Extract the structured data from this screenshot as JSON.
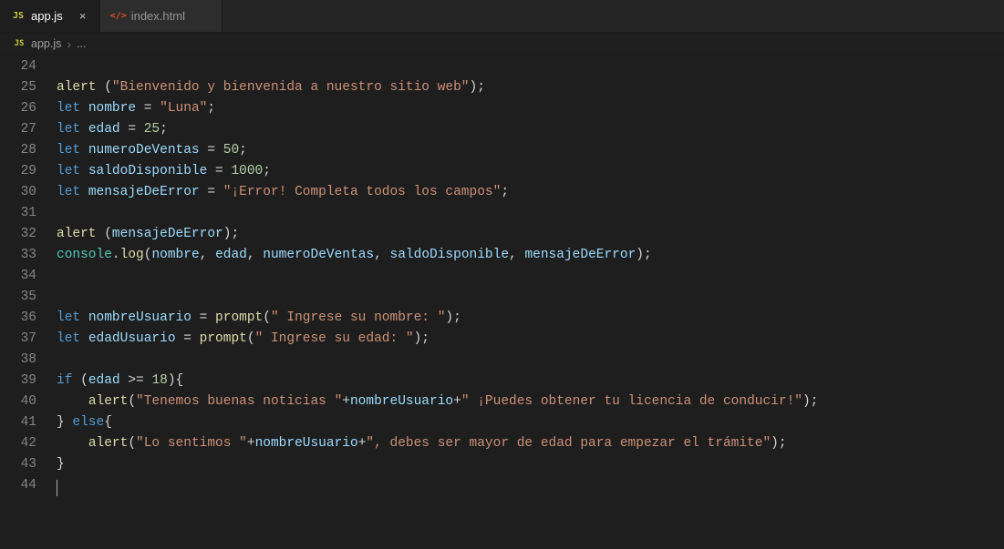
{
  "tabs": [
    {
      "label": "app.js",
      "icon": "JS",
      "iconClass": "js",
      "active": true
    },
    {
      "label": "index.html",
      "icon": "</>",
      "iconClass": "html",
      "active": false
    }
  ],
  "breadcrumb": {
    "icon": "JS",
    "file": "app.js",
    "rest": "..."
  },
  "lineStart": 24,
  "code": [
    [],
    [
      [
        "fn",
        "alert"
      ],
      [
        "pun",
        " ("
      ],
      [
        "str",
        "\"Bienvenido y bienvenida a nuestro sitio web\""
      ],
      [
        "pun",
        ");"
      ]
    ],
    [
      [
        "kw",
        "let"
      ],
      [
        "pun",
        " "
      ],
      [
        "var",
        "nombre"
      ],
      [
        "pun",
        " = "
      ],
      [
        "str",
        "\"Luna\""
      ],
      [
        "pun",
        ";"
      ]
    ],
    [
      [
        "kw",
        "let"
      ],
      [
        "pun",
        " "
      ],
      [
        "var",
        "edad"
      ],
      [
        "pun",
        " = "
      ],
      [
        "num",
        "25"
      ],
      [
        "pun",
        ";"
      ]
    ],
    [
      [
        "kw",
        "let"
      ],
      [
        "pun",
        " "
      ],
      [
        "var",
        "numeroDeVentas"
      ],
      [
        "pun",
        " = "
      ],
      [
        "num",
        "50"
      ],
      [
        "pun",
        ";"
      ]
    ],
    [
      [
        "kw",
        "let"
      ],
      [
        "pun",
        " "
      ],
      [
        "var",
        "saldoDisponible"
      ],
      [
        "pun",
        " = "
      ],
      [
        "num",
        "1000"
      ],
      [
        "pun",
        ";"
      ]
    ],
    [
      [
        "kw",
        "let"
      ],
      [
        "pun",
        " "
      ],
      [
        "var",
        "mensajeDeError"
      ],
      [
        "pun",
        " = "
      ],
      [
        "str",
        "\"¡Error! Completa todos los campos\""
      ],
      [
        "pun",
        ";"
      ]
    ],
    [],
    [
      [
        "fn",
        "alert"
      ],
      [
        "pun",
        " ("
      ],
      [
        "var",
        "mensajeDeError"
      ],
      [
        "pun",
        ");"
      ]
    ],
    [
      [
        "obj",
        "console"
      ],
      [
        "pun",
        "."
      ],
      [
        "fn",
        "log"
      ],
      [
        "pun",
        "("
      ],
      [
        "var",
        "nombre"
      ],
      [
        "pun",
        ", "
      ],
      [
        "var",
        "edad"
      ],
      [
        "pun",
        ", "
      ],
      [
        "var",
        "numeroDeVentas"
      ],
      [
        "pun",
        ", "
      ],
      [
        "var",
        "saldoDisponible"
      ],
      [
        "pun",
        ", "
      ],
      [
        "var",
        "mensajeDeError"
      ],
      [
        "pun",
        ");"
      ]
    ],
    [],
    [],
    [
      [
        "kw",
        "let"
      ],
      [
        "pun",
        " "
      ],
      [
        "var",
        "nombreUsuario"
      ],
      [
        "pun",
        " = "
      ],
      [
        "fn",
        "prompt"
      ],
      [
        "pun",
        "("
      ],
      [
        "str",
        "\" Ingrese su nombre: \""
      ],
      [
        "pun",
        ");"
      ]
    ],
    [
      [
        "kw",
        "let"
      ],
      [
        "pun",
        " "
      ],
      [
        "var",
        "edadUsuario"
      ],
      [
        "pun",
        " = "
      ],
      [
        "fn",
        "prompt"
      ],
      [
        "pun",
        "("
      ],
      [
        "str",
        "\" Ingrese su edad: \""
      ],
      [
        "pun",
        ");"
      ]
    ],
    [],
    [
      [
        "kw",
        "if"
      ],
      [
        "pun",
        " ("
      ],
      [
        "var",
        "edad"
      ],
      [
        "pun",
        " >= "
      ],
      [
        "num",
        "18"
      ],
      [
        "pun",
        "){"
      ]
    ],
    [
      [
        "pun",
        "    "
      ],
      [
        "fn",
        "alert"
      ],
      [
        "pun",
        "("
      ],
      [
        "str",
        "\"Tenemos buenas noticias \""
      ],
      [
        "pun",
        "+"
      ],
      [
        "var",
        "nombreUsuario"
      ],
      [
        "pun",
        "+"
      ],
      [
        "str",
        "\" ¡Puedes obtener tu licencia de conducir!\""
      ],
      [
        "pun",
        ");"
      ]
    ],
    [
      [
        "pun",
        "} "
      ],
      [
        "kw",
        "else"
      ],
      [
        "pun",
        "{"
      ]
    ],
    [
      [
        "pun",
        "    "
      ],
      [
        "fn",
        "alert"
      ],
      [
        "pun",
        "("
      ],
      [
        "str",
        "\"Lo sentimos \""
      ],
      [
        "pun",
        "+"
      ],
      [
        "var",
        "nombreUsuario"
      ],
      [
        "pun",
        "+"
      ],
      [
        "str",
        "\", debes ser mayor de edad para empezar el trámite\""
      ],
      [
        "pun",
        ");"
      ]
    ],
    [
      [
        "pun",
        "}"
      ]
    ],
    []
  ],
  "cursorLineIndex": 20
}
